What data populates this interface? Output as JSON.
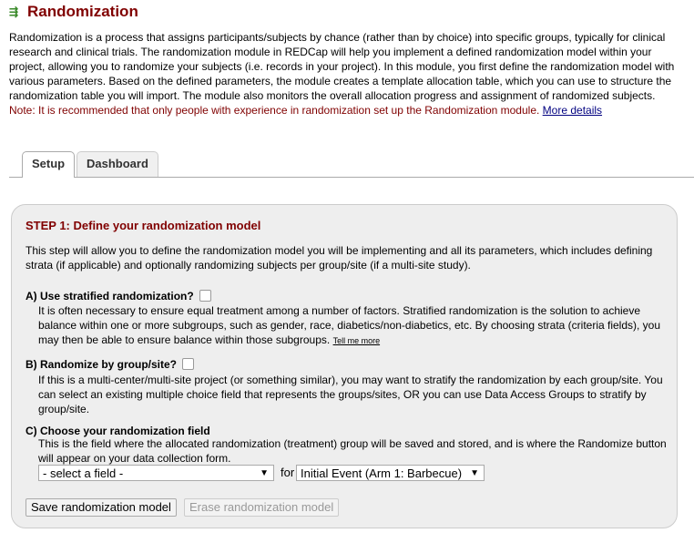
{
  "header": {
    "title": "Randomization",
    "icon": "randomize-icon"
  },
  "intro": {
    "text": "Randomization is a process that assigns participants/subjects by chance (rather than by choice) into specific groups, typically for clinical research and clinical trials. The randomization module in REDCap will help you implement a defined randomization model within your project, allowing you to randomize your subjects (i.e. records in your project). In this module, you first define the randomization model with various parameters. Based on the defined parameters, the module creates a template allocation table, which you can use to structure the randomization table you will import. The module also monitors the overall allocation progress and assignment of randomized subjects. ",
    "note": "Note: It is recommended that only people with experience in randomization set up the Randomization module.",
    "link": "More details"
  },
  "tabs": [
    {
      "label": "Setup"
    },
    {
      "label": "Dashboard"
    }
  ],
  "step": {
    "title": "STEP 1: Define your randomization model",
    "desc": "This step will allow you to define the randomization model you will be implementing and all its parameters, which includes defining strata (if applicable) and optionally randomizing subjects per group/site (if a multi-site study).",
    "a": {
      "title": "A) Use stratified randomization?",
      "desc": "It is often necessary to ensure equal treatment among a number of factors. Stratified randomization is the solution to achieve balance within one or more subgroups, such as gender, race, diabetics/non-diabetics, etc. By choosing strata (criteria fields), you may then be able to ensure balance within those subgroups.",
      "link": "Tell me more"
    },
    "b": {
      "title": "B) Randomize by group/site?",
      "desc": "If this is a multi-center/multi-site project (or something similar), you may want to stratify the randomization by each group/site. You can select an existing multiple choice field that represents the groups/sites, OR you can use Data Access Groups to stratify by group/site."
    },
    "c": {
      "title": "C) Choose your randomization field",
      "desc": "This is the field where the allocated randomization (treatment) group will be saved and stored, and is where the Randomize button will appear on your data collection form.",
      "field_select": "- select a field -",
      "for_label": "for",
      "event_select": "Initial Event (Arm 1: Barbecue)"
    },
    "save_button": "Save randomization model",
    "erase_button": "Erase randomization model"
  }
}
